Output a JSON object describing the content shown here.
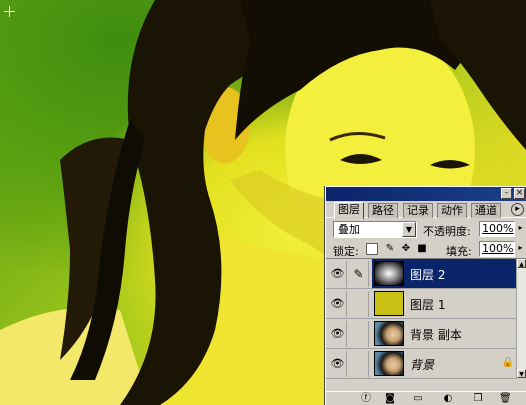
{
  "palette": {
    "tabs": [
      {
        "label": "图层"
      },
      {
        "label": "路径"
      },
      {
        "label": "记录"
      },
      {
        "label": "动作"
      },
      {
        "label": "通道"
      }
    ],
    "blend_mode": "叠加",
    "opacity_label": "不透明度:",
    "opacity_value": "100%",
    "lock_label": "锁定:",
    "fill_label": "填充:",
    "fill_value": "100%",
    "layers": [
      {
        "name": "图层 2",
        "selected": true,
        "thumb": "gradient"
      },
      {
        "name": "图层 1",
        "selected": false,
        "thumb": "solid-yellow"
      },
      {
        "name": "背景 副本",
        "selected": false,
        "thumb": "photo"
      },
      {
        "name": "背景",
        "selected": false,
        "thumb": "photo",
        "locked": true
      }
    ]
  },
  "icons": {
    "eye": "eye-icon",
    "brush": "brush-icon",
    "lock": "lock-icon",
    "move": "move-icon"
  },
  "colors": {
    "selection": "#0a246a",
    "panel": "#d4d0c8",
    "photo_green": "#4b9310",
    "photo_yellow": "#e6e028"
  }
}
